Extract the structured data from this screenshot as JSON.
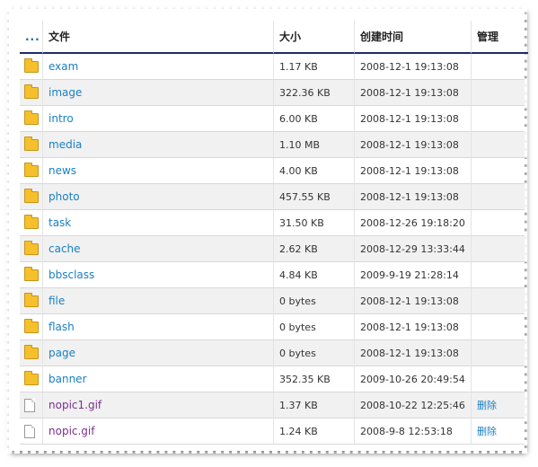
{
  "header": {
    "up_label": "...",
    "col_name": "文件",
    "col_size": "大小",
    "col_time": "创建时间",
    "col_manage": "管理"
  },
  "rows": [
    {
      "type": "folder",
      "name": "exam",
      "size": "1.17 KB",
      "time": "2008-12-1 19:13:08",
      "action": ""
    },
    {
      "type": "folder",
      "name": "image",
      "size": "322.36 KB",
      "time": "2008-12-1 19:13:08",
      "action": ""
    },
    {
      "type": "folder",
      "name": "intro",
      "size": "6.00 KB",
      "time": "2008-12-1 19:13:08",
      "action": ""
    },
    {
      "type": "folder",
      "name": "media",
      "size": "1.10 MB",
      "time": "2008-12-1 19:13:08",
      "action": ""
    },
    {
      "type": "folder",
      "name": "news",
      "size": "4.00 KB",
      "time": "2008-12-1 19:13:08",
      "action": ""
    },
    {
      "type": "folder",
      "name": "photo",
      "size": "457.55 KB",
      "time": "2008-12-1 19:13:08",
      "action": ""
    },
    {
      "type": "folder",
      "name": "task",
      "size": "31.50 KB",
      "time": "2008-12-26 19:18:20",
      "action": ""
    },
    {
      "type": "folder",
      "name": "cache",
      "size": "2.62 KB",
      "time": "2008-12-29 13:33:44",
      "action": ""
    },
    {
      "type": "folder",
      "name": "bbsclass",
      "size": "4.84 KB",
      "time": "2009-9-19 21:28:14",
      "action": ""
    },
    {
      "type": "folder",
      "name": "file",
      "size": "0 bytes",
      "time": "2008-12-1 19:13:08",
      "action": ""
    },
    {
      "type": "folder",
      "name": "flash",
      "size": "0 bytes",
      "time": "2008-12-1 19:13:08",
      "action": ""
    },
    {
      "type": "folder",
      "name": "page",
      "size": "0 bytes",
      "time": "2008-12-1 19:13:08",
      "action": ""
    },
    {
      "type": "folder",
      "name": "banner",
      "size": "352.35 KB",
      "time": "2009-10-26 20:49:54",
      "action": ""
    },
    {
      "type": "file",
      "name": "nopic1.gif",
      "size": "1.37 KB",
      "time": "2008-10-22 12:25:46",
      "action": "删除"
    },
    {
      "type": "file",
      "name": "nopic.gif",
      "size": "1.24 KB",
      "time": "2008-9-8 12:53:18",
      "action": "删除"
    }
  ],
  "icons": {
    "folder": "folder-icon",
    "file": "file-icon"
  },
  "colors": {
    "link": "#1a7fc3",
    "file_link": "#7a2f8e",
    "header_rule": "#1f2a6b",
    "alt_row": "#f1f1f1"
  }
}
